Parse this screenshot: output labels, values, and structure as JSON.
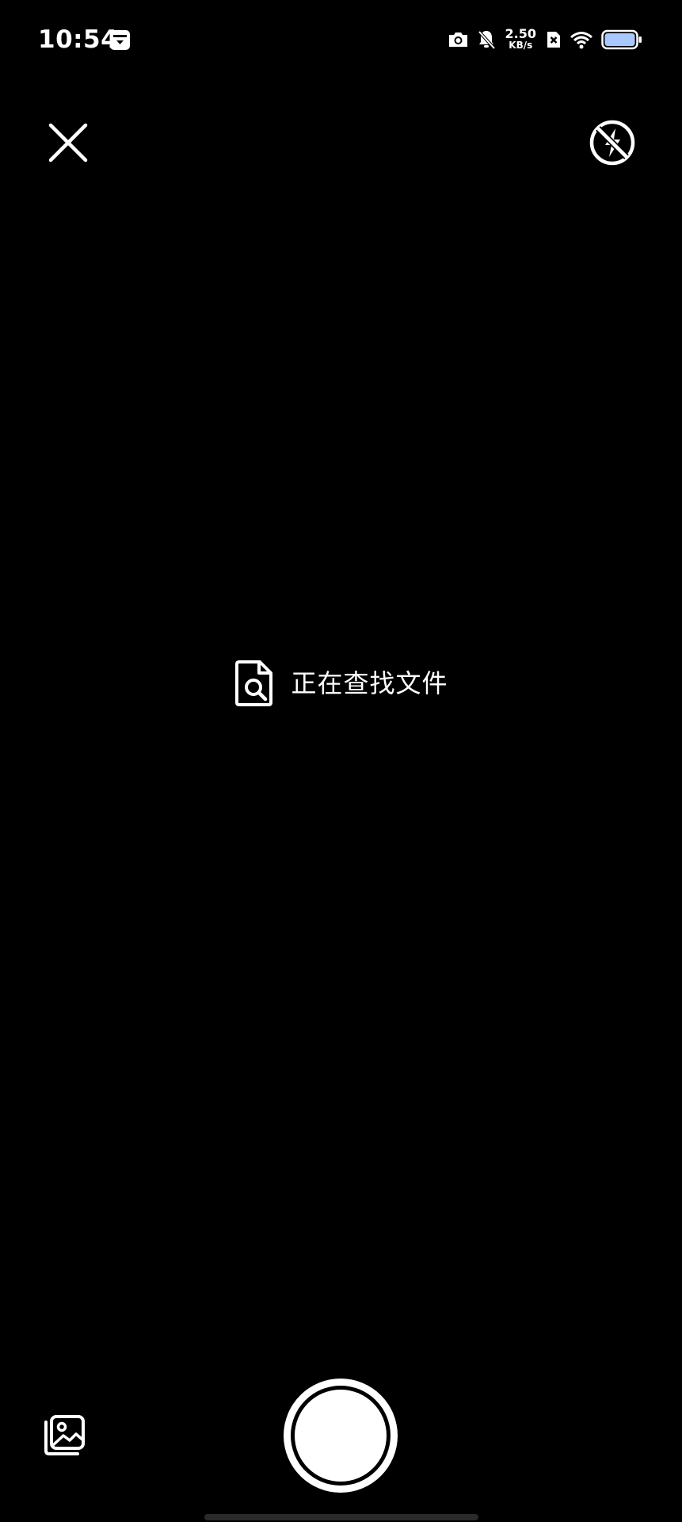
{
  "status_bar": {
    "time": "10:54",
    "net_speed_value": "2.50",
    "net_speed_unit": "KB/s",
    "icons": [
      "calendar-icon",
      "camera-icon",
      "bell-off-icon",
      "sim-no-signal-icon",
      "wifi-icon",
      "battery-icon"
    ]
  },
  "top_controls": {
    "close_icon": "close-icon",
    "flash_icon": "flash-off-icon"
  },
  "center": {
    "status_text": "正在查找文件",
    "icon": "document-search-icon"
  },
  "bottom_controls": {
    "gallery_icon": "gallery-icon",
    "shutter": "shutter-button"
  },
  "colors": {
    "background": "#000000",
    "foreground": "#ffffff",
    "battery_fill": "#a9c8ff"
  }
}
